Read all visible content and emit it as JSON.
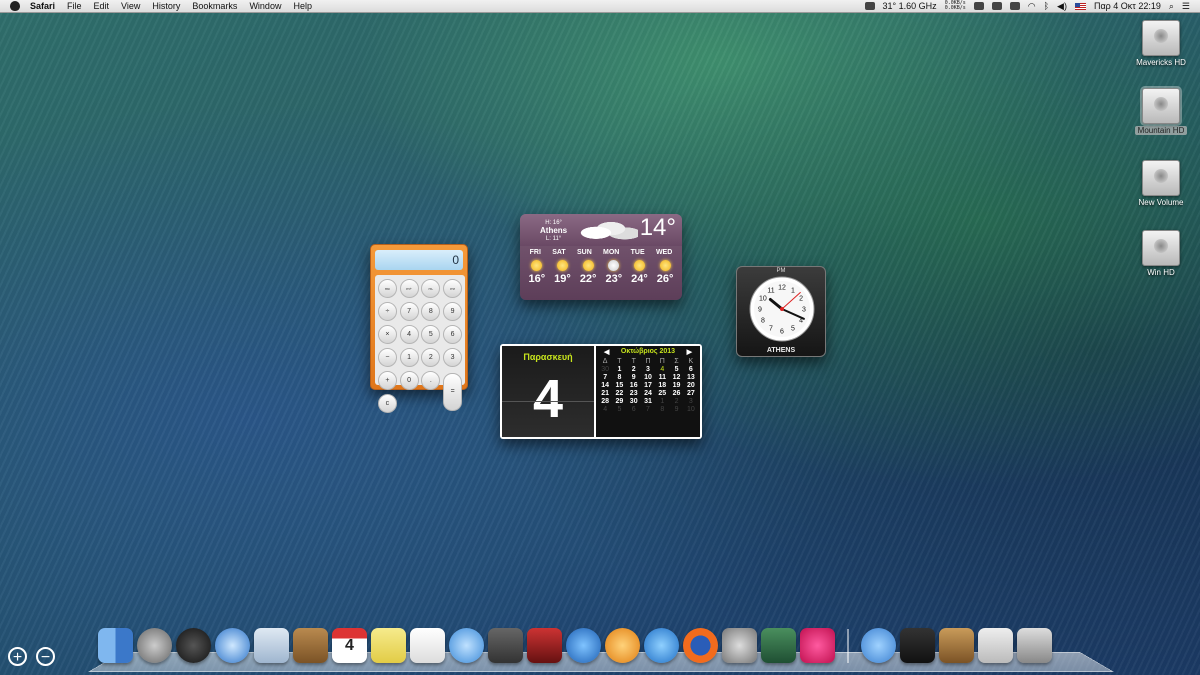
{
  "menubar": {
    "app": "Safari",
    "items": [
      "File",
      "Edit",
      "View",
      "History",
      "Bookmarks",
      "Window",
      "Help"
    ],
    "cpu_status": "31° 1.60 GHz",
    "net_up": "0.0KB/s",
    "net_down": "0.0KB/s",
    "clock": "Παρ 4 Οκτ 22:19"
  },
  "drives": [
    "Mavericks HD",
    "Mountain HD",
    "New Volume",
    "Win HD"
  ],
  "weather": {
    "high": "H: 16°",
    "city": "Athens",
    "low": "L: 11°",
    "temp": "14°",
    "days": [
      "FRI",
      "SAT",
      "SUN",
      "MON",
      "TUE",
      "WED"
    ],
    "temps": [
      "16°",
      "19°",
      "22°",
      "23°",
      "24°",
      "26°"
    ]
  },
  "calculator": {
    "display": "0",
    "keys": [
      "mc",
      "m+",
      "m-",
      "mr",
      "÷",
      "7",
      "8",
      "9",
      "×",
      "4",
      "5",
      "6",
      "−",
      "1",
      "2",
      "3",
      "+",
      "0",
      ".",
      "c",
      "="
    ]
  },
  "calendar": {
    "day_name": "Παρασκευή",
    "day_number": "4",
    "month_label": "Οκτώβριος 2013",
    "weekdays": [
      "Δ",
      "Τ",
      "Τ",
      "Π",
      "Π",
      "Σ",
      "Κ"
    ],
    "days": [
      "30",
      "1",
      "2",
      "3",
      "4",
      "5",
      "6",
      "7",
      "8",
      "9",
      "10",
      "11",
      "12",
      "13",
      "14",
      "15",
      "16",
      "17",
      "18",
      "19",
      "20",
      "21",
      "22",
      "23",
      "24",
      "25",
      "26",
      "27",
      "28",
      "29",
      "30",
      "31",
      "1",
      "2",
      "3",
      "4",
      "5",
      "6",
      "7",
      "8",
      "9",
      "10"
    ]
  },
  "clock": {
    "ampm": "PM",
    "city": "ATHENS",
    "hour": 10,
    "minute": 19,
    "second": 8
  },
  "dock": {
    "apps": [
      "finder-icon",
      "launchpad-icon",
      "dashboard-icon",
      "safari-icon",
      "mail-icon",
      "contacts-icon",
      "calendar-icon",
      "notes-icon",
      "reminders-icon",
      "messages-icon",
      "facetime-icon",
      "photo-booth-icon",
      "itunes-icon",
      "ibooks-icon",
      "app-store-icon",
      "firefox-icon",
      "system-preferences-icon",
      "grapher-icon",
      "heart-app-icon"
    ],
    "right_items": [
      "applications-folder-icon",
      "activity-monitor-icon",
      "downloads-stack-icon",
      "documents-stack-icon",
      "trash-icon"
    ]
  },
  "dashboard_controls": {
    "add": "+",
    "remove": "−"
  }
}
